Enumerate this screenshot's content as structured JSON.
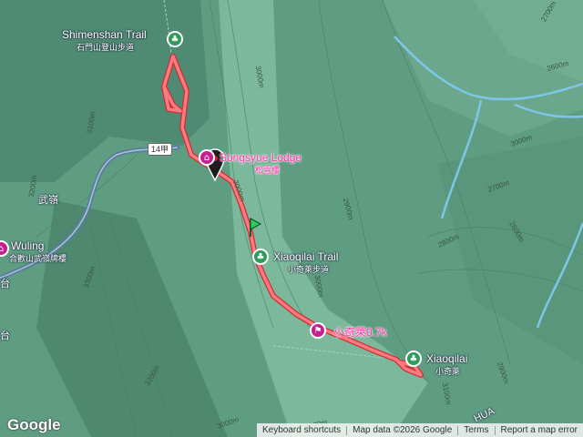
{
  "map": {
    "colors": {
      "land": "#5f9d82",
      "ridge": "#8fc4a6",
      "river": "#7ec6e6",
      "road": "#5b7d9a",
      "track": "#ff6f73",
      "brand": "#ff2fa6"
    },
    "places": {
      "shimenshan": {
        "en": "Shimenshan Trail",
        "zh": "石門山登山步道",
        "icon": "park-icon"
      },
      "songsyue": {
        "en": "Songsyue Lodge",
        "zh": "松雪樓",
        "icon": "lodge-icon"
      },
      "xiaoqilai_trail": {
        "en": "Xiaoqilai Trail",
        "zh": "小奇萊步道",
        "icon": "park-icon"
      },
      "xiaoqilai_dist": {
        "zh": "小奇萊0.7k",
        "icon": "hiker-icon"
      },
      "xiaoqilai": {
        "en": "Xiaoqilai",
        "zh": "小奇萊",
        "icon": "park-icon"
      },
      "wuling": {
        "en": "Wuling",
        "zh": "合歡山武嶺牌樓",
        "icon": "poi-icon"
      },
      "wuling_ridge": {
        "zh": "武嶺"
      },
      "edge_text_1": {
        "zh": "台"
      },
      "edge_text_2": {
        "zh": "台"
      }
    },
    "road_shield": "14甲",
    "partial_label": "HUA",
    "elevations": [
      "3100m",
      "3200m",
      "3300m",
      "3000m",
      "3000m",
      "2900m",
      "2800m",
      "2700m",
      "2600m",
      "2700m",
      "3000m",
      "3100m",
      "3200m",
      "3000m",
      "3100m",
      "2900m",
      "3000m",
      "2800m"
    ],
    "start_flag": "start-flag-icon",
    "end_pin": "end-pin-icon"
  },
  "footer": {
    "logo": "Google",
    "keyboard": "Keyboard shortcuts",
    "data": "Map data ©2026 Google",
    "terms": "Terms",
    "report": "Report a map error"
  }
}
